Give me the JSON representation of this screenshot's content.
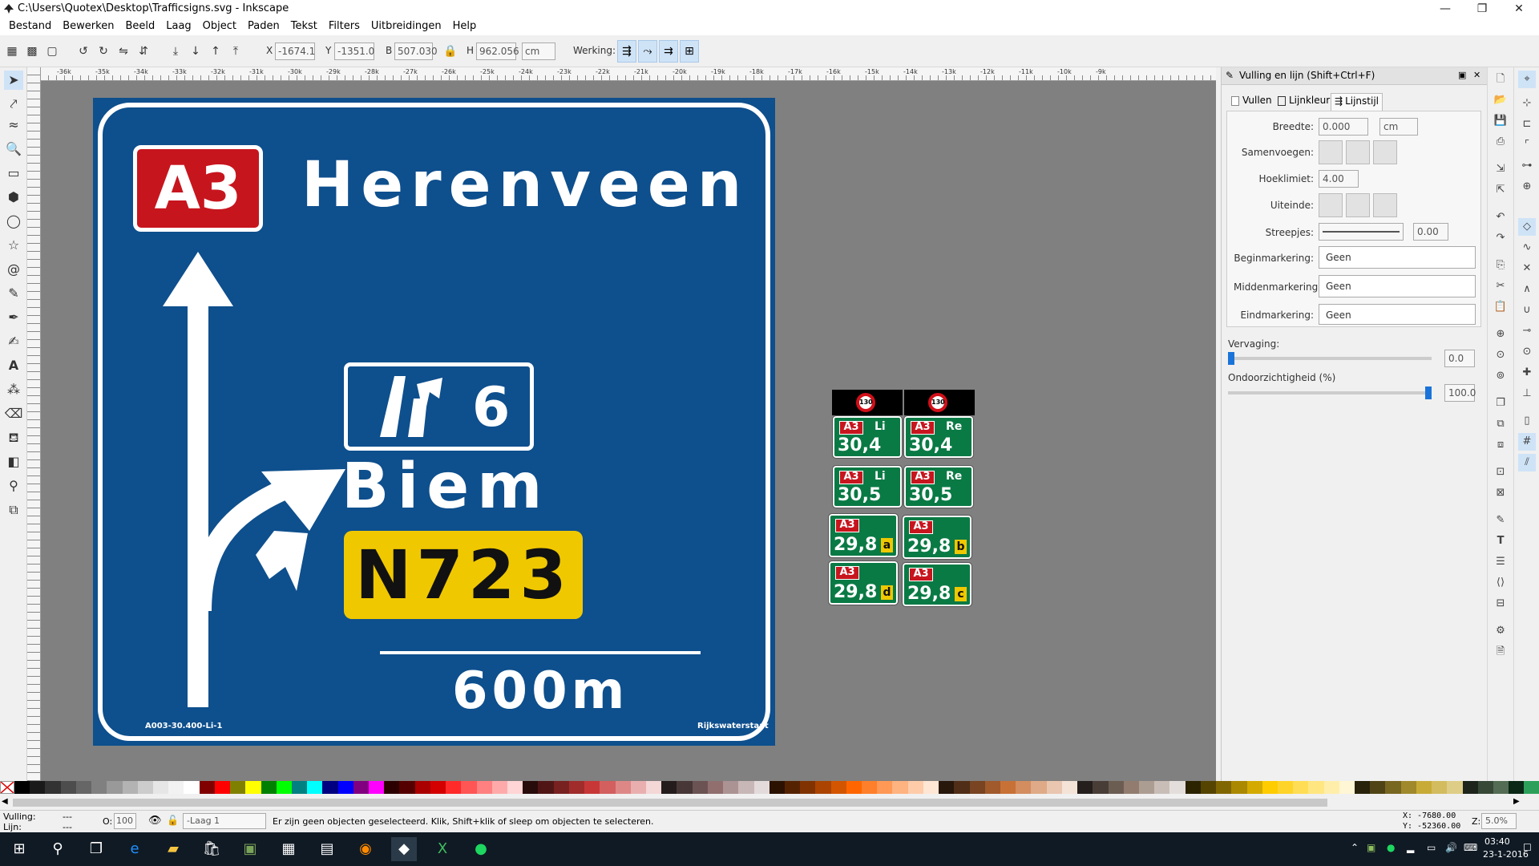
{
  "window": {
    "title": "C:\\Users\\Quotex\\Desktop\\Trafficsigns.svg - Inkscape",
    "min": "—",
    "max": "❐",
    "close": "✕"
  },
  "menu": [
    "Bestand",
    "Bewerken",
    "Beeld",
    "Laag",
    "Object",
    "Paden",
    "Tekst",
    "Filters",
    "Uitbreidingen",
    "Help"
  ],
  "toolbar": {
    "x_label": "X",
    "x_value": "-1674.1",
    "y_label": "Y",
    "y_value": "-1351.0",
    "w_label": "B",
    "w_value": "507.030",
    "h_label": "H",
    "h_value": "962.056",
    "unit": "cm",
    "op_label": "Werking:"
  },
  "ruler": [
    "-36k",
    "-35k",
    "-34k",
    "-33k",
    "-32k",
    "-31k",
    "-30k",
    "-29k",
    "-28k",
    "-27k",
    "-26k",
    "-25k",
    "-24k",
    "-23k",
    "-22k",
    "-21k",
    "-20k",
    "-19k",
    "-18k",
    "-17k",
    "-16k",
    "-15k",
    "-14k",
    "-13k",
    "-12k",
    "-11k",
    "-10k",
    "-9k"
  ],
  "sign": {
    "route": "A3",
    "destination": "Herenveen",
    "exit_number": "6",
    "town": "Biem",
    "road": "N723",
    "distance": "600m",
    "code": "A003-30.400-Li-1",
    "authority": "Rijkswaterstaat",
    "colors": {
      "blue": "#0e4f8d",
      "red": "#c7151e",
      "yellow": "#f0c800"
    }
  },
  "mini_signs": {
    "speed": "130",
    "items": [
      {
        "route": "A3",
        "side": "Li",
        "km": "30,4",
        "letter": ""
      },
      {
        "route": "A3",
        "side": "Re",
        "km": "30,4",
        "letter": ""
      },
      {
        "route": "A3",
        "side": "Li",
        "km": "30,5",
        "letter": ""
      },
      {
        "route": "A3",
        "side": "Re",
        "km": "30,5",
        "letter": ""
      },
      {
        "route": "A3",
        "side": "",
        "km": "29,8",
        "letter": "a"
      },
      {
        "route": "A3",
        "side": "",
        "km": "29,8",
        "letter": "b"
      },
      {
        "route": "A3",
        "side": "",
        "km": "29,8",
        "letter": "d"
      },
      {
        "route": "A3",
        "side": "",
        "km": "29,8",
        "letter": "c"
      }
    ]
  },
  "dock": {
    "title": "Vulling en lijn (Shift+Ctrl+F)",
    "tabs": {
      "fill": "Vullen",
      "stroke_paint": "Lijnkleur",
      "stroke_style": "Lijnstijl"
    },
    "width_label": "Breedte:",
    "width_value": "0.000",
    "width_unit": "cm",
    "join_label": "Samenvoegen:",
    "miter_label": "Hoeklimiet:",
    "miter_value": "4.00",
    "cap_label": "Uiteinde:",
    "dash_label": "Streepjes:",
    "dash_value": "0.00",
    "start_marker_label": "Beginmarkering:",
    "start_marker": "Geen",
    "mid_marker_label": "Middenmarkering:",
    "mid_marker": "Geen",
    "end_marker_label": "Eindmarkering:",
    "end_marker": "Geen",
    "blur_label": "Vervaging:",
    "blur_value": "0.0",
    "blur_level": 0,
    "opacity_label": "Ondoorzichtigheid (%)",
    "opacity_value": "100.0",
    "opacity_level": 1
  },
  "status": {
    "fill_label": "Vulling:",
    "fill_value": "---",
    "stroke_label": "Lijn:",
    "stroke_value": "---",
    "opacity_label": "O:",
    "opacity_value": "100",
    "layer": "-Laag 1",
    "message": "Er zijn geen objecten geselecteerd.  Klik, Shift+klik of sleep om objecten te selecteren.",
    "x_coord": "X:  -7680.00",
    "y_coord": "Y: -52360.00",
    "zoom_label": "Z:",
    "zoom_value": "5.0%"
  },
  "taskbar": {
    "time": "03:40",
    "date": "23-1-2016"
  }
}
